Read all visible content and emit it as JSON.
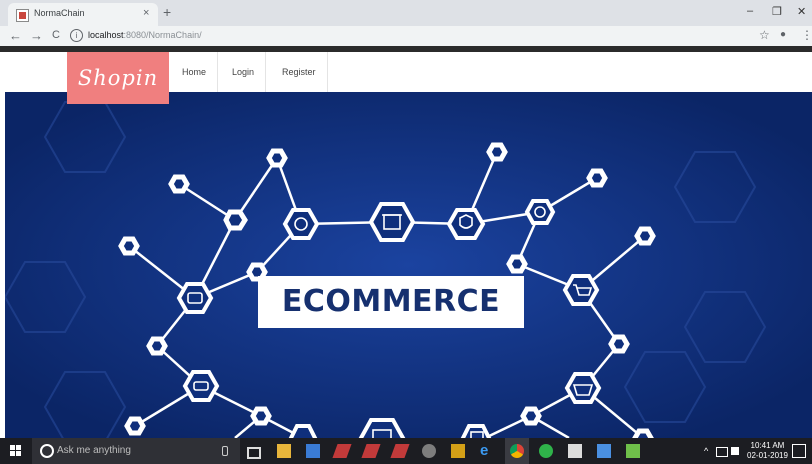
{
  "browser": {
    "tab": {
      "title": "NormaChain",
      "close": "×"
    },
    "new_tab": "+",
    "window": {
      "minimize": "–",
      "maximize": "❐",
      "close": "✕"
    },
    "nav": {
      "back": "←",
      "forward": "→",
      "reload": "C"
    },
    "address": {
      "host": "localhost",
      "rest": ":8080/NormaChain/"
    },
    "bookmark": "☆",
    "profile": "●",
    "menu": "⋮"
  },
  "site": {
    "logo": "Shopin",
    "nav": [
      {
        "label": "Home"
      },
      {
        "label": "Login"
      },
      {
        "label": "Register"
      }
    ],
    "hero": {
      "banner": "ECOMMERCE",
      "icons": [
        "shop-icon",
        "shield-check-icon",
        "coin-icon",
        "refresh-icon",
        "buy-tag-icon",
        "cart-icon",
        "close-tag-icon",
        "basket-icon",
        "laptop-cart-icon",
        "store-icon"
      ]
    }
  },
  "taskbar": {
    "search_placeholder": "Ask me anything",
    "apps": [
      "task-view-icon",
      "file-explorer-icon",
      "app-icon",
      "app-icon",
      "app-icon",
      "app-icon",
      "app-icon",
      "app-icon",
      "edge-icon",
      "chrome-icon",
      "app-icon",
      "app-icon",
      "app-icon",
      "app-icon"
    ],
    "tray": {
      "arrow": "^",
      "time": "10:41 AM",
      "date": "02-01-2019"
    }
  },
  "colors": {
    "hero_bg": "#0f2f7c",
    "logo_bg": "#f07f7f",
    "banner_text": "#16306f"
  }
}
